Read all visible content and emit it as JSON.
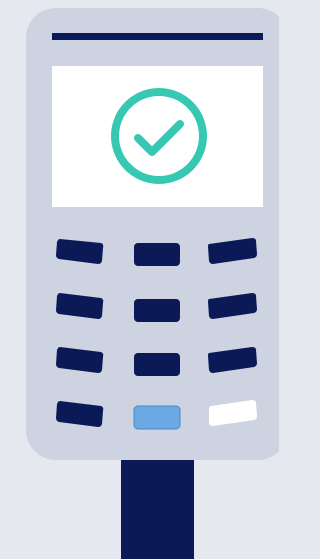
{
  "illustration": {
    "subject": "card-payment-terminal",
    "icons": [
      "checkmark-circle-icon"
    ],
    "colors": {
      "background": "#e6e8ef",
      "body": "#cdd3e0",
      "navy": "#0b1a57",
      "screen": "#ffffff",
      "check": "#37c8b4",
      "key_blue": "#6aa9e3",
      "key_white": "#ffffff"
    },
    "keypad": {
      "rows": 4,
      "columns": 3,
      "highlighted_keys": [
        "key-r4-c2",
        "key-r4-c3"
      ]
    }
  }
}
